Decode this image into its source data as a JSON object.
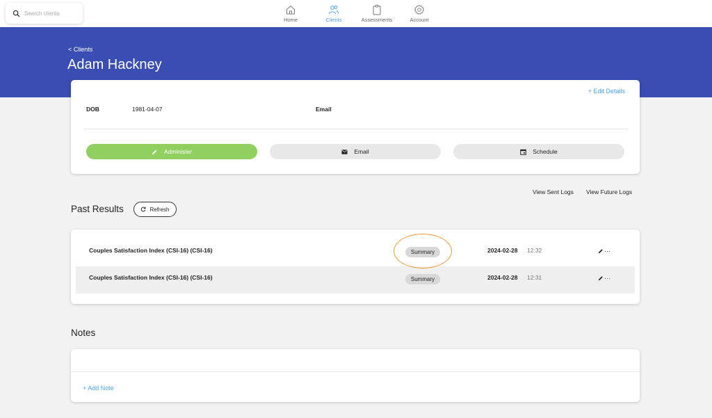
{
  "search": {
    "placeholder": "Search clients"
  },
  "nav": {
    "home": "Home",
    "clients": "Clients",
    "assessments": "Assessments",
    "account": "Account",
    "active": "Clients"
  },
  "header": {
    "breadcrumb": "< Clients",
    "client_name": "Adam Hackney"
  },
  "details": {
    "edit_label": "+ Edit Details",
    "dob_label": "DOB",
    "dob_value": "1981-04-07",
    "email_label": "Email",
    "actions": {
      "administer": "Administer",
      "email": "Email",
      "schedule": "Schedule"
    }
  },
  "logs": {
    "sent": "View Sent Logs",
    "future": "View Future Logs"
  },
  "past_results": {
    "title": "Past Results",
    "refresh_label": "Refresh",
    "rows": [
      {
        "name": "Couples Satisfaction Index (CSI-16) (CSI-16)",
        "badge": "Summary",
        "date": "2024-02-28",
        "time": "12:32",
        "more": "···"
      },
      {
        "name": "Couples Satisfaction Index (CSI-16) (CSI-16)",
        "badge": "Summary",
        "date": "2024-02-28",
        "time": "12:31",
        "more": "···"
      }
    ]
  },
  "notes": {
    "title": "Notes",
    "add_label": "+ Add Note"
  },
  "colors": {
    "brand_blue": "#3a4db3",
    "accent_link": "#4aa3e8",
    "administer_green": "#8fd060",
    "highlight_orange": "#ef9a33"
  }
}
